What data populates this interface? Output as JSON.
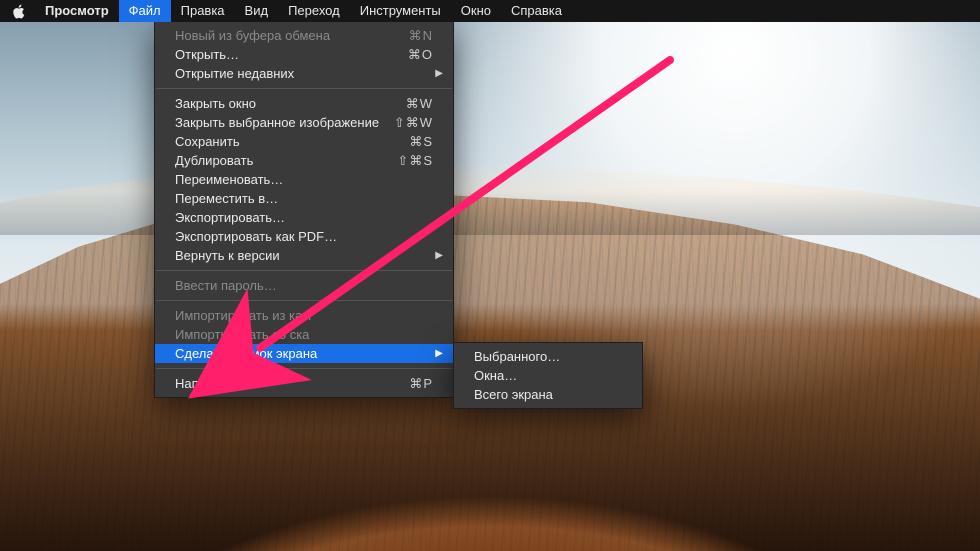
{
  "menubar": {
    "app_name": "Просмотр",
    "items": [
      {
        "label": "Файл",
        "active": true
      },
      {
        "label": "Правка"
      },
      {
        "label": "Вид"
      },
      {
        "label": "Переход"
      },
      {
        "label": "Инструменты"
      },
      {
        "label": "Окно"
      },
      {
        "label": "Справка"
      }
    ]
  },
  "dropdown": {
    "groups": [
      [
        {
          "label": "Новый из буфера обмена",
          "shortcut": "⌘N",
          "disabled": true
        },
        {
          "label": "Открыть…",
          "shortcut": "⌘O"
        },
        {
          "label": "Открытие недавних",
          "submenu": true
        }
      ],
      [
        {
          "label": "Закрыть окно",
          "shortcut": "⌘W"
        },
        {
          "label": "Закрыть выбранное изображение",
          "shortcut": "⇧⌘W"
        },
        {
          "label": "Сохранить",
          "shortcut": "⌘S"
        },
        {
          "label": "Дублировать",
          "shortcut": "⇧⌘S"
        },
        {
          "label": "Переименовать…"
        },
        {
          "label": "Переместить в…"
        },
        {
          "label": "Экспортировать…"
        },
        {
          "label": "Экспортировать как PDF…"
        },
        {
          "label": "Вернуть к версии",
          "submenu": true
        }
      ],
      [
        {
          "label": "Ввести пароль…",
          "disabled": true
        }
      ],
      [
        {
          "label": "Импортировать из кам",
          "disabled": true
        },
        {
          "label": "Импортировать со ска",
          "disabled": true
        },
        {
          "label": "Сделать снимок экрана",
          "submenu": true,
          "highlight": true
        }
      ],
      [
        {
          "label": "Напечатать…",
          "shortcut": "⌘P"
        }
      ]
    ]
  },
  "submenu": {
    "items": [
      {
        "label": "Выбранного…"
      },
      {
        "label": "Окна…"
      },
      {
        "label": "Всего экрана"
      }
    ]
  },
  "annotation": {
    "color": "#ff1f6b"
  }
}
